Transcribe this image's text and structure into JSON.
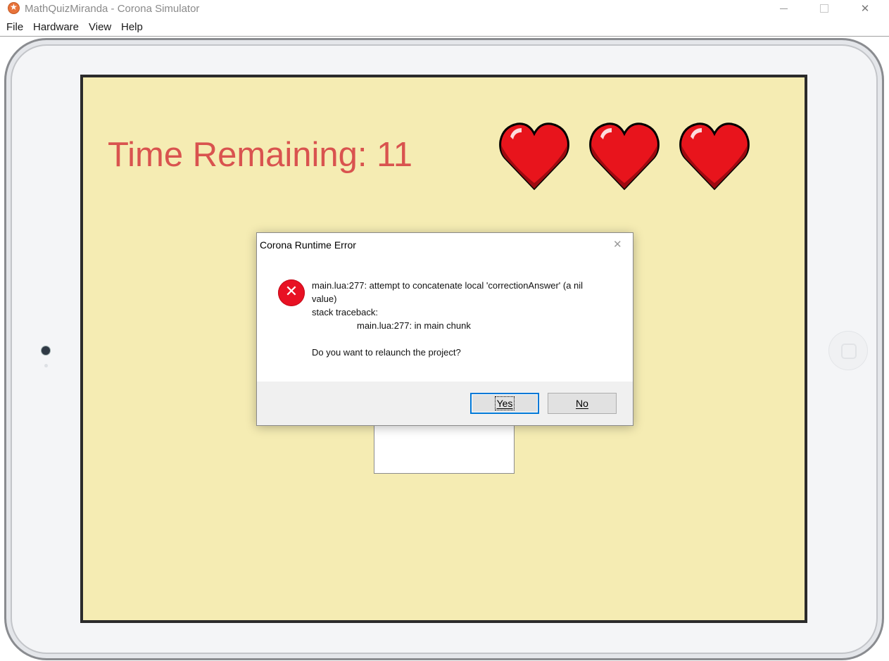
{
  "window": {
    "title": "MathQuizMiranda - Corona Simulator",
    "controls": [
      "minimize",
      "maximize",
      "close"
    ]
  },
  "menu": [
    "File",
    "Hardware",
    "View",
    "Help"
  ],
  "game": {
    "time_remaining_label": "Time Remaining: 11",
    "lives": 3,
    "heart_color": "#e8141c",
    "background_color": "#f5ecb3"
  },
  "dialog": {
    "title": "Corona Runtime Error",
    "message_lines": [
      "main.lua:277: attempt to concatenate local 'correctionAnswer' (a nil",
      "value)",
      "stack traceback:",
      "main.lua:277: in main chunk",
      "Do you want to relaunch the project?"
    ],
    "icon": "error-icon",
    "buttons": {
      "yes": "Yes",
      "no": "No"
    }
  }
}
